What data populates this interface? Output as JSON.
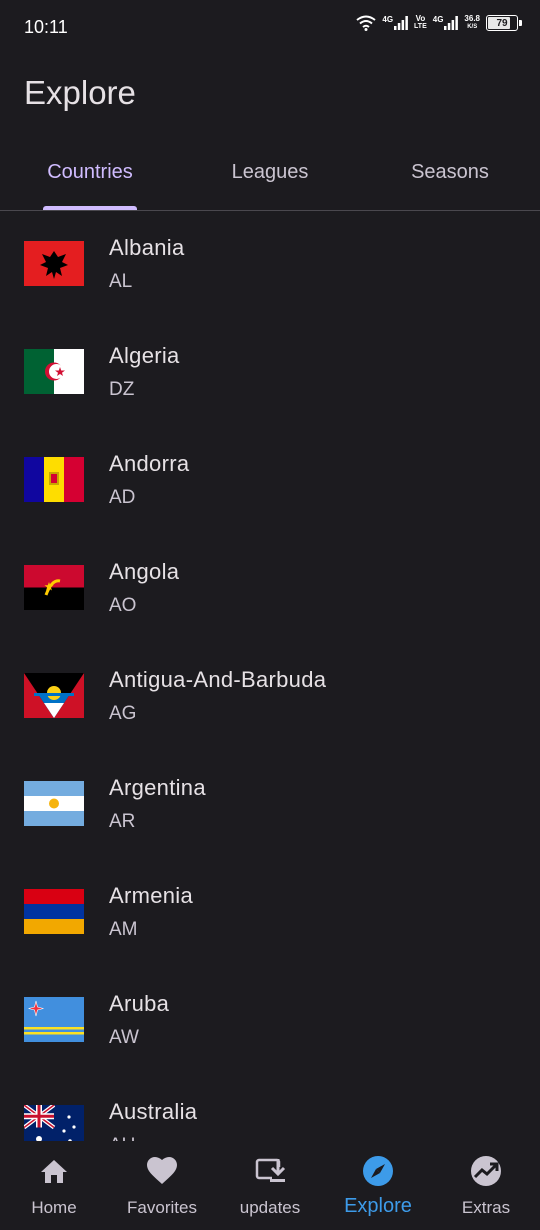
{
  "status_bar": {
    "time": "10:11",
    "network_1": "4G",
    "volte_top": "Vo",
    "volte_bottom": "LTE",
    "network_2": "4G",
    "speed_value": "36.8",
    "speed_unit": "K/S",
    "battery": "79",
    "battery_fraction": 0.79
  },
  "header": {
    "title": "Explore"
  },
  "tabs": [
    {
      "label": "Countries",
      "active": true
    },
    {
      "label": "Leagues",
      "active": false
    },
    {
      "label": "Seasons",
      "active": false
    }
  ],
  "countries": [
    {
      "name": "Albania",
      "code": "AL"
    },
    {
      "name": "Algeria",
      "code": "DZ"
    },
    {
      "name": "Andorra",
      "code": "AD"
    },
    {
      "name": "Angola",
      "code": "AO"
    },
    {
      "name": "Antigua-And-Barbuda",
      "code": "AG"
    },
    {
      "name": "Argentina",
      "code": "AR"
    },
    {
      "name": "Armenia",
      "code": "AM"
    },
    {
      "name": "Aruba",
      "code": "AW"
    },
    {
      "name": "Australia",
      "code": "AU"
    }
  ],
  "bottom_nav": [
    {
      "label": "Home",
      "icon": "home-icon"
    },
    {
      "label": "Favorites",
      "icon": "heart-icon"
    },
    {
      "label": "updates",
      "icon": "download-icon"
    },
    {
      "label": "Explore",
      "icon": "compass-icon",
      "active": true
    },
    {
      "label": "Extras",
      "icon": "trending-icon"
    }
  ],
  "colors": {
    "background": "#1c1b1f",
    "tab_active": "#d0bcff",
    "nav_active": "#3d9be9"
  }
}
